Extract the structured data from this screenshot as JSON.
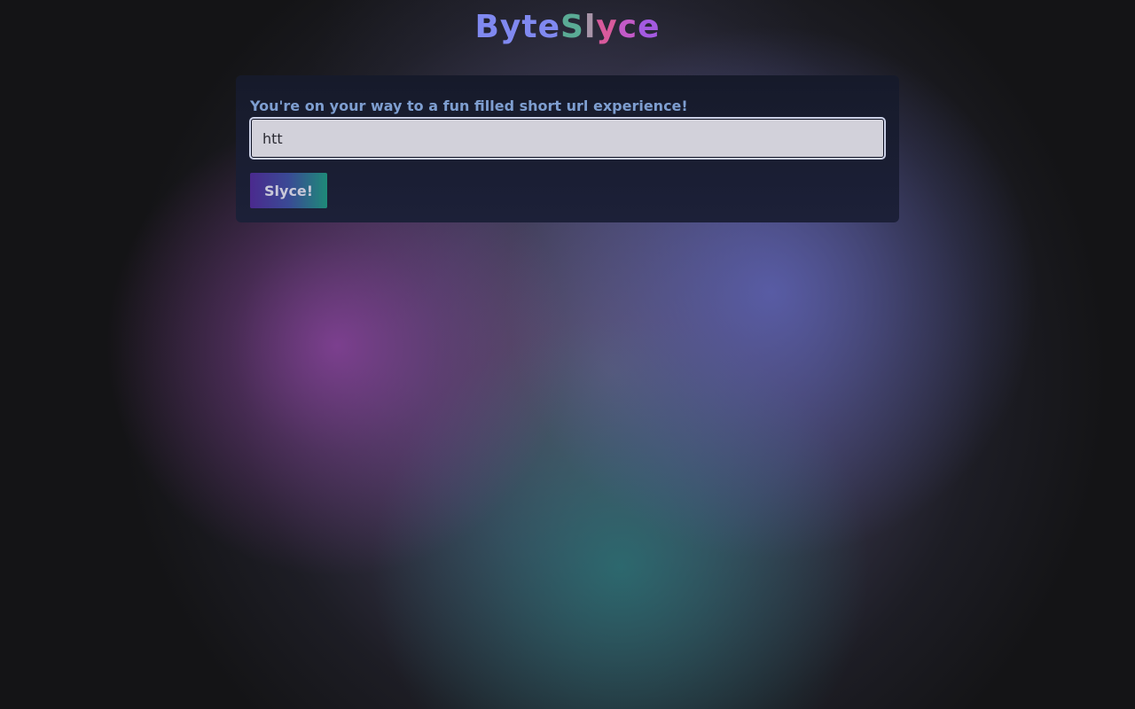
{
  "brand": {
    "parts": [
      "Byte",
      "S",
      "l",
      "y",
      "c",
      "e"
    ],
    "colors": [
      "#8089f0",
      "#5aab95",
      "#a894a8",
      "#d85a9c",
      "#c35ac8",
      "#a45ae0"
    ]
  },
  "form": {
    "label": "You're on your way to a fun filled short url experience!",
    "url_value": "htt",
    "submit_label": "Slyce!"
  },
  "colors": {
    "page_background": "#141416",
    "card_background": "#1a1e33",
    "label_text": "#7e9ed0",
    "input_background": "#d2d1da"
  }
}
